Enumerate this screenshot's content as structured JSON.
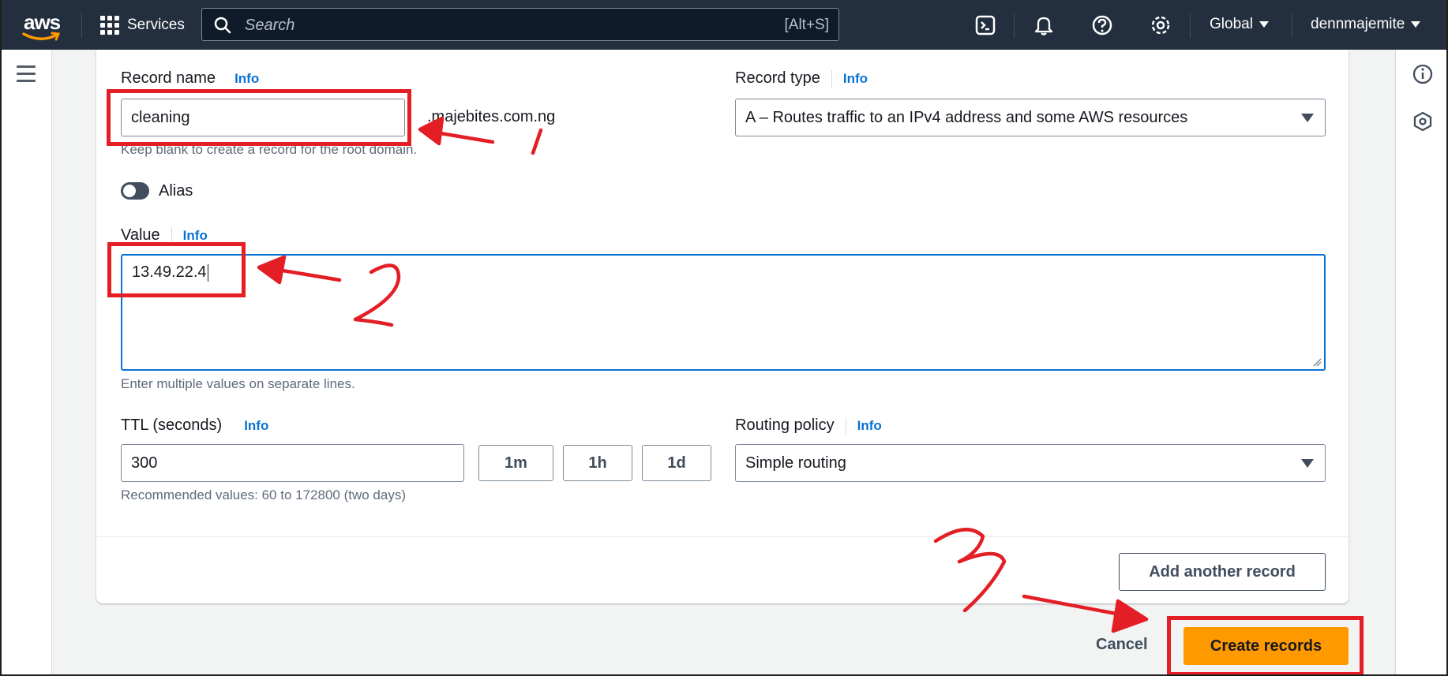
{
  "nav": {
    "services_label": "Services",
    "search_placeholder": "Search",
    "search_shortcut": "[Alt+S]",
    "region": "Global",
    "account": "dennmajemite"
  },
  "form": {
    "record_name": {
      "label": "Record name",
      "info": "Info",
      "value": "cleaning",
      "suffix": ".majebites.com.ng",
      "hint": "Keep blank to create a record for the root domain."
    },
    "record_type": {
      "label": "Record type",
      "info": "Info",
      "value": "A – Routes traffic to an IPv4 address and some AWS resources"
    },
    "alias": {
      "label": "Alias",
      "enabled": false
    },
    "value": {
      "label": "Value",
      "info": "Info",
      "text": "13.49.22.4",
      "hint": "Enter multiple values on separate lines."
    },
    "ttl": {
      "label": "TTL (seconds)",
      "info": "Info",
      "value": "300",
      "presets": [
        "1m",
        "1h",
        "1d"
      ],
      "hint": "Recommended values: 60 to 172800 (two days)"
    },
    "routing_policy": {
      "label": "Routing policy",
      "info": "Info",
      "value": "Simple routing"
    },
    "add_another_label": "Add another record"
  },
  "footer": {
    "cancel_label": "Cancel",
    "create_label": "Create records"
  },
  "colors": {
    "nav_bg": "#232f3e",
    "primary_button": "#ff9900",
    "link_info": "#0972d3",
    "annotation": "#e31e24"
  }
}
